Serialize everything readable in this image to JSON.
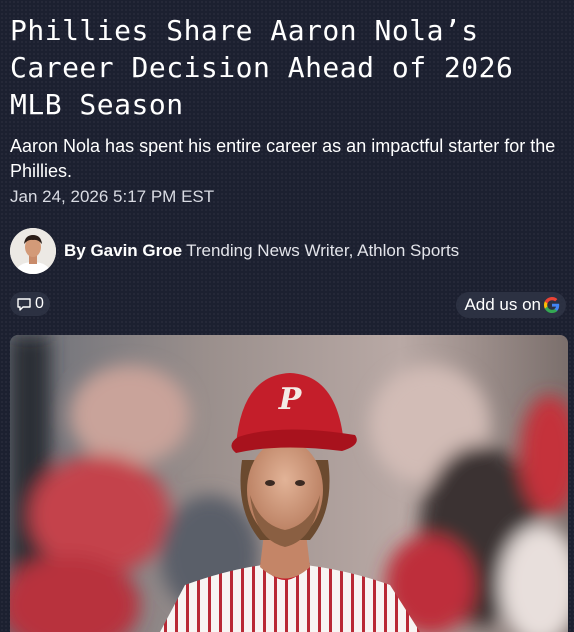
{
  "article": {
    "headline": "Phillies Share Aaron Nola’s Career Decision Ahead of 2026 MLB Season",
    "dek": "Aaron Nola has spent his entire career as an impactful starter for the Phillies.",
    "timestamp": "Jan 24, 2026 5:17 PM EST"
  },
  "byline": {
    "prefix_author": "By Gavin Groe",
    "role": "Trending News Writer, Athlon Sports"
  },
  "actions": {
    "comment_count": "0",
    "comment_icon": "comment-icon",
    "google_label": "Add us on",
    "google_icon": "google-icon"
  },
  "hero": {
    "cap_logo": "P"
  },
  "colors": {
    "background": "#1c2030",
    "pill": "#2c3142",
    "cap_red": "#c41e2a"
  }
}
